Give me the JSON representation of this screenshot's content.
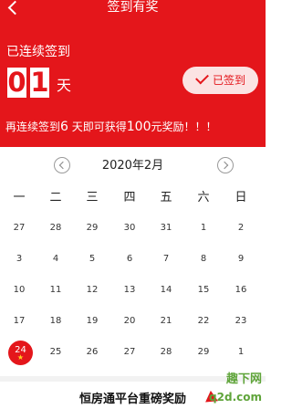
{
  "header": {
    "title": "签到有奖",
    "streak_label": "已连续签到",
    "streak_digit_1": "0",
    "streak_digit_2": "1",
    "streak_unit": "天",
    "signed_button_label": "已签到",
    "reward_prefix": "再连续签到",
    "reward_days": "6",
    "reward_middle": " 天即可获得",
    "reward_amount": "100",
    "reward_suffix": "元奖励！！！",
    "background_color": "#e4161b"
  },
  "calendar": {
    "month_label": "2020年2月",
    "weekdays": [
      "一",
      "二",
      "三",
      "四",
      "五",
      "六",
      "日"
    ],
    "weeks": [
      [
        "27",
        "28",
        "29",
        "30",
        "31",
        "1",
        "2"
      ],
      [
        "3",
        "4",
        "5",
        "6",
        "7",
        "8",
        "9"
      ],
      [
        "10",
        "11",
        "12",
        "13",
        "14",
        "15",
        "16"
      ],
      [
        "17",
        "18",
        "19",
        "20",
        "21",
        "22",
        "23"
      ],
      [
        "24",
        "25",
        "26",
        "27",
        "28",
        "29",
        "1"
      ]
    ],
    "today": "24",
    "today_marker": "★"
  },
  "promo": {
    "title": "恒房通平台重磅奖励"
  },
  "watermark": {
    "line1": "趣下网",
    "line2": "q2d.com"
  }
}
